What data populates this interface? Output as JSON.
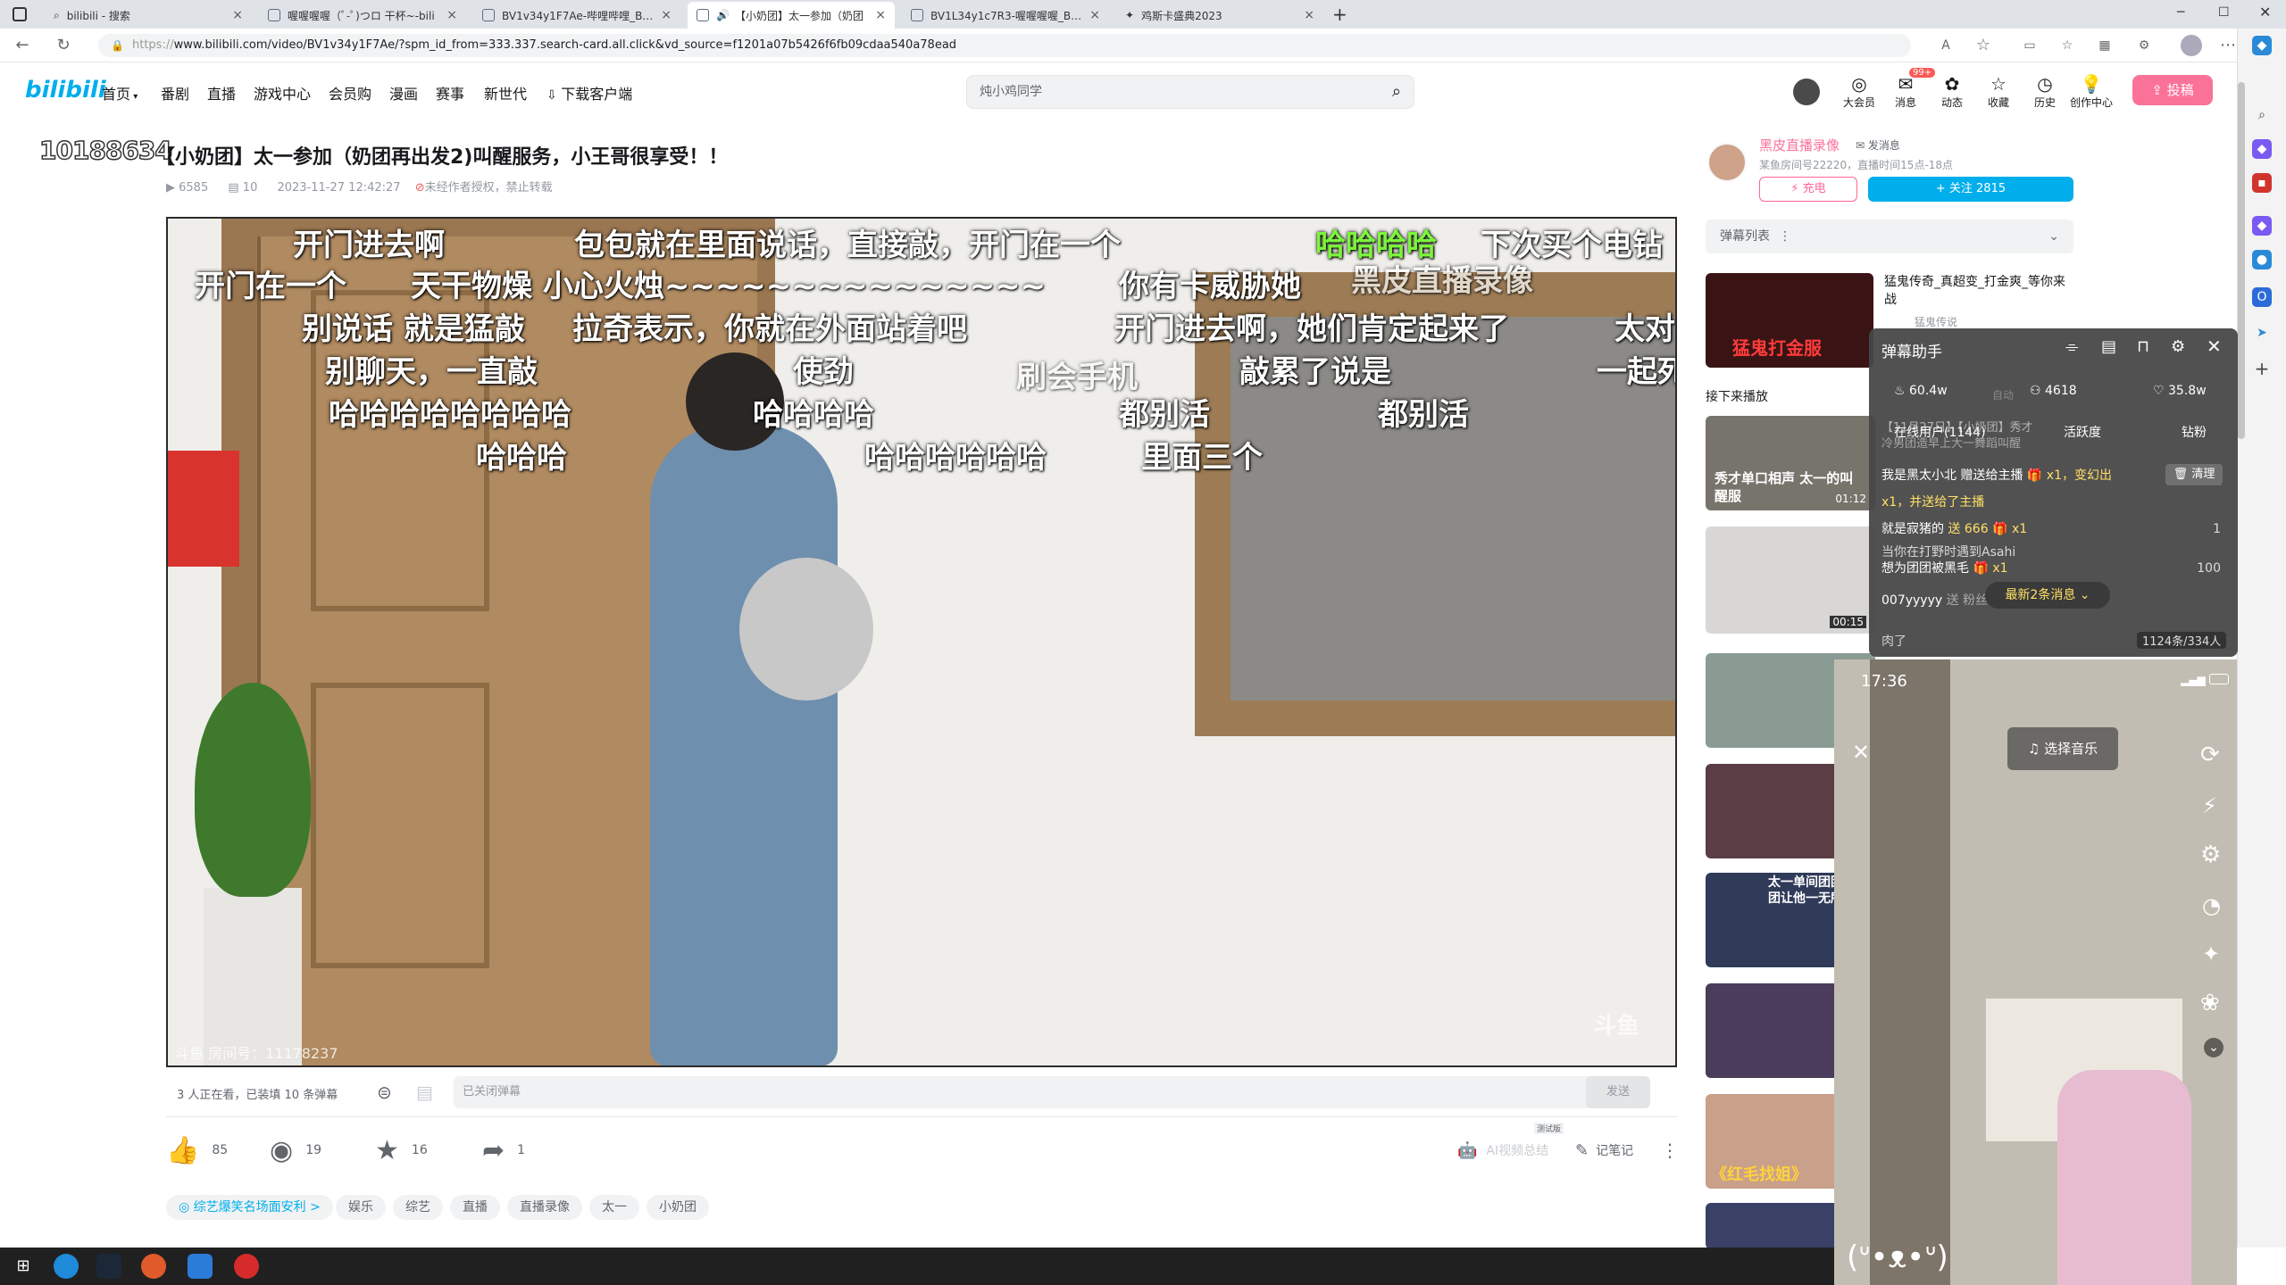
{
  "browser": {
    "tabs": [
      {
        "title": "bilibili - 搜索",
        "active": false
      },
      {
        "title": "喔喔喔喔（ﾟ-ﾟ)つロ 干杯~-bili",
        "active": false
      },
      {
        "title": "BV1v34y1F7Ae-哔哩哔哩_Bilibili",
        "active": false
      },
      {
        "title": "【小奶团】太一参加（奶团",
        "active": true
      },
      {
        "title": "BV1L34y1c7R3-喔喔喔喔_Bilibili",
        "active": false
      },
      {
        "title": "鸡斯卡盛典2023",
        "active": false
      }
    ],
    "url_prefix": "https://",
    "url": "www.bilibili.com/video/BV1v34y1F7Ae/?spm_id_from=333.337.search-card.all.click&vd_source=f1201a07b5426f6fb09cdaa540a78ead"
  },
  "header": {
    "logo": "bilibili",
    "nav": [
      "首页",
      "番剧",
      "直播",
      "游戏中心",
      "会员购",
      "漫画",
      "赛事",
      "新世代",
      "下载客户端"
    ],
    "search_placeholder": "炖小鸡同学",
    "right_items": [
      "大会员",
      "消息",
      "动态",
      "收藏",
      "历史",
      "创作中心"
    ],
    "msg_badge": "99+",
    "upload_label": "投稿"
  },
  "video": {
    "corner_number": "10188634",
    "title": "【小奶团】太一参加（奶团再出发2)叫醒服务，小王哥很享受！！",
    "views": "6585",
    "danmaku_count": "10",
    "datetime": "2023-11-27 12:42:27",
    "copyright": "未经作者授权，禁止转载",
    "danmaku_lines": [
      {
        "text": "开门进去啊",
        "color": "#ffffff"
      },
      {
        "text": "包包就在里面说话，直接敲，开门在一个",
        "color": "#ffffff"
      },
      {
        "text": "哈哈哈哈",
        "color": "#7cf53a"
      },
      {
        "text": "下次买个电钻",
        "color": "#ffffff"
      },
      {
        "text": "开门在一个",
        "color": "#ffffff"
      },
      {
        "text": "天干物燥 小心火烛~~~~~~~~~~~~~~~",
        "color": "#ffffff"
      },
      {
        "text": "你有卡威胁她",
        "color": "#ffffff"
      },
      {
        "text": "黑皮直播录像",
        "color": "#ffffff"
      },
      {
        "text": "别说话 就是猛敲",
        "color": "#ffffff"
      },
      {
        "text": "拉奇表示，你就在外面站着吧",
        "color": "#ffffff"
      },
      {
        "text": "开门进去啊，她们肯定起来了",
        "color": "#ffffff"
      },
      {
        "text": "太对",
        "color": "#ffffff"
      },
      {
        "text": "别聊天，一直敲",
        "color": "#ffffff"
      },
      {
        "text": "使劲",
        "color": "#ffffff"
      },
      {
        "text": "刷会手机",
        "color": "#ffffff"
      },
      {
        "text": "敲累了说是",
        "color": "#ffffff"
      },
      {
        "text": "一起死",
        "color": "#ffffff"
      },
      {
        "text": "哈哈哈哈哈哈哈哈",
        "color": "#ffffff"
      },
      {
        "text": "哈哈哈哈",
        "color": "#ffffff"
      },
      {
        "text": "都别活",
        "color": "#ffffff"
      },
      {
        "text": "都别活",
        "color": "#ffffff"
      },
      {
        "text": "哈哈哈",
        "color": "#ffffff"
      },
      {
        "text": "哈哈哈哈哈哈",
        "color": "#ffffff"
      },
      {
        "text": "里面三个",
        "color": "#ffffff"
      }
    ],
    "room_watermark": "斗鱼 房间号：11178237",
    "corner_logo": "斗鱼",
    "viewer_status": "3 人正在看，已装填 10 条弹幕",
    "danmaku_input_placeholder": "已关闭弹幕",
    "send_label": "发送",
    "likes": "85",
    "coins": "19",
    "favorites": "16",
    "shares": "1",
    "ai_summary": "AI视频总结",
    "ai_badge": "测试版",
    "notes_label": "记笔记",
    "tags": [
      "综艺爆笑名场面安利 >",
      "娱乐",
      "综艺",
      "直播",
      "直播录像",
      "太一",
      "小奶团"
    ]
  },
  "uploader": {
    "name": "黑皮直播录像",
    "message_label": "发消息",
    "desc": "某鱼房间号22220，直播时间15点-18点",
    "charge_label": "充电",
    "follow_label": "+ 关注 2815"
  },
  "danmaku_list": {
    "label": "弹幕列表"
  },
  "recommend": {
    "first_title": "猛鬼传奇_真超变_打金爽_等你来战",
    "first_sub": "猛鬼传说",
    "first_thumb_text": "猛鬼打金服",
    "up_next_label": "接下来播放",
    "thumbs": [
      {
        "text": "秀才单口相声 太一的叫醒服",
        "time": "01:12"
      },
      {
        "text": "",
        "time": "00:15"
      },
      {
        "text": "",
        "time": ""
      },
      {
        "text": "",
        "time": ""
      },
      {
        "text": "太一单间团团 团团让他一无所",
        "time": ""
      },
      {
        "text": "",
        "time": ""
      },
      {
        "text": "《红毛找姐》",
        "time": ""
      },
      {
        "text": "",
        "time": ""
      }
    ]
  },
  "helper": {
    "title": "弹幕助手",
    "stat_hot": "60.4w",
    "stat_people": "4618",
    "stat_like": "35.8w",
    "auto_label": "自动",
    "tabs": [
      "在线用户(1144)",
      "活跃度",
      "钻粉"
    ],
    "clear_label": "清理",
    "messages": [
      {
        "user": "我是黑太小北",
        "text": "赠送给主播",
        "suffix": "x1，变幻出",
        "tail": "x1，并送给了主播"
      },
      {
        "user": "就是寂猪的",
        "text": "送 666",
        "suffix": "x1",
        "count": "1"
      },
      {
        "user": "想为团团被黑毛",
        "text": "",
        "suffix": "x1",
        "count": "100"
      },
      {
        "user": "007yyyyy",
        "text": "送 粉丝",
        "suffix": "",
        "count": ""
      }
    ],
    "partial_text_1": "【11月27日】【小奶团】秀才",
    "partial_text_2": "冷男团造早上大一舞蹈叫醒",
    "partial_text_3": "当你在打野时遇到Asahi",
    "partial_text_4": "肉了",
    "new_msg_label": "最新2条消息",
    "footer_count": "1124条/334人"
  },
  "phone": {
    "time": "17:36",
    "music_label": "选择音乐"
  }
}
